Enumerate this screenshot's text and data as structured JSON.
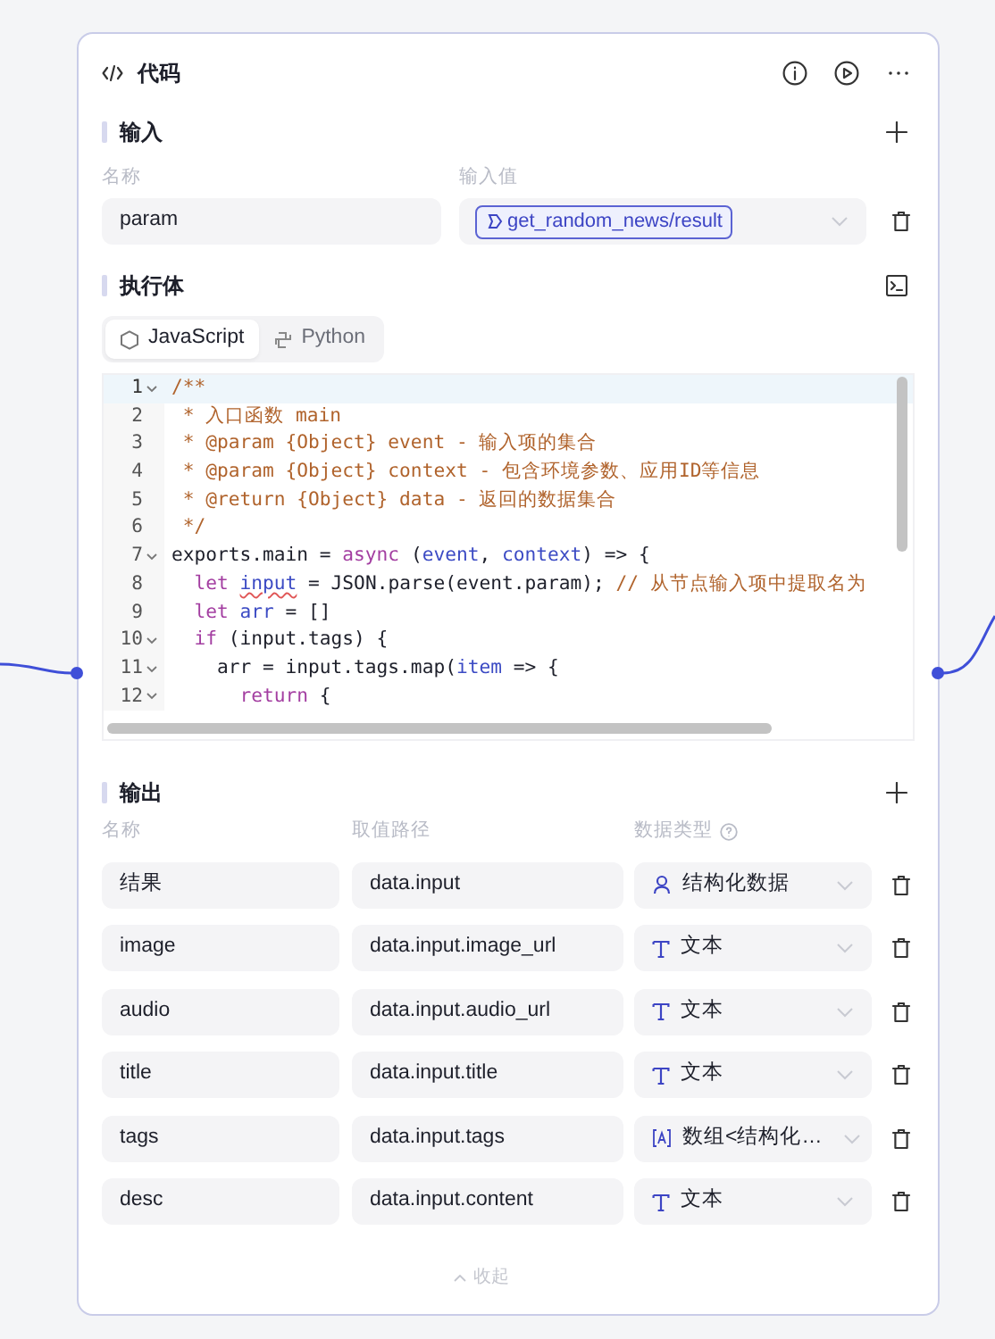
{
  "node": {
    "title": "代码"
  },
  "input": {
    "title": "输入",
    "columns": [
      "名称",
      "输入值"
    ],
    "rows": [
      {
        "name": "param",
        "value": "get_random_news/result"
      }
    ]
  },
  "body": {
    "title": "执行体",
    "tabs": [
      {
        "label": "JavaScript",
        "selected": true
      },
      {
        "label": "Python",
        "selected": false
      }
    ],
    "code": [
      {
        "number": "1",
        "fold": true,
        "active": true,
        "tokens": [
          {
            "kind": "comment",
            "text": "/**"
          }
        ]
      },
      {
        "number": "2",
        "fold": false,
        "active": false,
        "tokens": [
          {
            "kind": "comment",
            "text": " * 入口函数 main"
          }
        ]
      },
      {
        "number": "3",
        "fold": false,
        "active": false,
        "tokens": [
          {
            "kind": "comment",
            "text": " * @param {Object} event - 输入项的集合"
          }
        ]
      },
      {
        "number": "4",
        "fold": false,
        "active": false,
        "tokens": [
          {
            "kind": "comment",
            "text": " * @param {Object} context - 包含环境参数、应用ID等信息"
          }
        ]
      },
      {
        "number": "5",
        "fold": false,
        "active": false,
        "tokens": [
          {
            "kind": "comment",
            "text": " * @return {Object} data - 返回的数据集合"
          }
        ]
      },
      {
        "number": "6",
        "fold": false,
        "active": false,
        "tokens": [
          {
            "kind": "comment",
            "text": " */"
          }
        ]
      },
      {
        "number": "7",
        "fold": true,
        "active": false,
        "tokens": [
          {
            "kind": "plain",
            "text": "exports.main = "
          },
          {
            "kind": "keyword",
            "text": "async"
          },
          {
            "kind": "plain",
            "text": " ("
          },
          {
            "kind": "var",
            "text": "event"
          },
          {
            "kind": "plain",
            "text": ", "
          },
          {
            "kind": "var",
            "text": "context"
          },
          {
            "kind": "plain",
            "text": ") => {"
          }
        ]
      },
      {
        "number": "8",
        "fold": false,
        "active": false,
        "tokens": [
          {
            "kind": "keyword",
            "text": "  let "
          },
          {
            "kind": "var",
            "text": "input",
            "flagged": true
          },
          {
            "kind": "plain",
            "text": " = JSON.parse(event.param); "
          },
          {
            "kind": "comment",
            "text": "// 从节点输入项中提取名为"
          }
        ]
      },
      {
        "number": "9",
        "fold": false,
        "active": false,
        "tokens": [
          {
            "kind": "keyword",
            "text": "  let "
          },
          {
            "kind": "var",
            "text": "arr"
          },
          {
            "kind": "plain",
            "text": " = []"
          }
        ]
      },
      {
        "number": "10",
        "fold": true,
        "active": false,
        "tokens": [
          {
            "kind": "keyword",
            "text": "  if"
          },
          {
            "kind": "plain",
            "text": " (input.tags) {"
          }
        ]
      },
      {
        "number": "11",
        "fold": true,
        "active": false,
        "tokens": [
          {
            "kind": "plain",
            "text": "    arr = input.tags.map("
          },
          {
            "kind": "var",
            "text": "item"
          },
          {
            "kind": "plain",
            "text": " => {"
          }
        ]
      },
      {
        "number": "12",
        "fold": true,
        "active": false,
        "tokens": [
          {
            "kind": "keyword",
            "text": "      return"
          },
          {
            "kind": "plain",
            "text": " {"
          }
        ]
      }
    ]
  },
  "output": {
    "title": "输出",
    "columns": [
      "名称",
      "取值路径",
      "数据类型"
    ],
    "rows": [
      {
        "name": "结果",
        "path": "data.input",
        "type": {
          "kind": "object",
          "label": "结构化数据"
        }
      },
      {
        "name": "image",
        "path": "data.input.image_url",
        "type": {
          "kind": "string",
          "label": "文本"
        }
      },
      {
        "name": "audio",
        "path": "data.input.audio_url",
        "type": {
          "kind": "string",
          "label": "文本"
        }
      },
      {
        "name": "title",
        "path": "data.input.title",
        "type": {
          "kind": "string",
          "label": "文本"
        }
      },
      {
        "name": "tags",
        "path": "data.input.tags",
        "type": {
          "kind": "array",
          "label": "数组<结构化…"
        }
      },
      {
        "name": "desc",
        "path": "data.input.content",
        "type": {
          "kind": "string",
          "label": "文本"
        }
      }
    ]
  },
  "collapse": {
    "label": "收起"
  }
}
